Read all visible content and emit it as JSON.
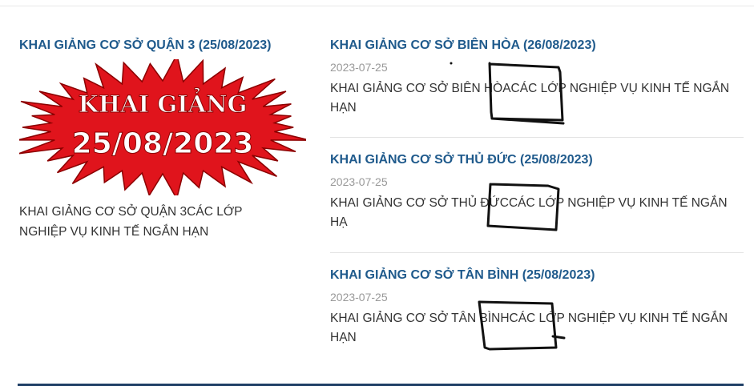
{
  "featured": {
    "title": "KHAI GIẢNG CƠ SỞ QUẬN 3 (25/08/2023)",
    "banner": {
      "line1": "KHAI GIẢNG",
      "line2": "25/08/2023",
      "colors": {
        "burst": "#e0141c",
        "text": "#ffffff",
        "outline": "#8b0000"
      }
    },
    "excerpt": "KHAI GIẢNG CƠ SỞ QUẬN 3CÁC LỚP NGHIỆP VỤ KINH TẾ NGẮN HẠN"
  },
  "news": [
    {
      "title": "KHAI GIẢNG CƠ SỞ BIÊN HÒA (26/08/2023)",
      "date": "2023-07-25",
      "excerpt": "KHAI GIẢNG CƠ SỞ BIÊN HÒACÁC LỚP NGHIỆP VỤ KINH TẾ NGẮN HẠN"
    },
    {
      "title": "KHAI GIẢNG CƠ SỞ THỦ ĐỨC (25/08/2023)",
      "date": "2023-07-25",
      "excerpt": "KHAI GIẢNG CƠ SỞ THỦ ĐỨCCÁC LỚP NGHIỆP VỤ KINH TẾ NGẮN HẠ"
    },
    {
      "title": "KHAI GIẢNG CƠ SỞ TÂN BÌNH (25/08/2023)",
      "date": "2023-07-25",
      "excerpt": "KHAI GIẢNG CƠ SỞ TÂN BÌNHCÁC LỚP NGHIỆP VỤ KINH TẾ NGẮN HẠN"
    }
  ],
  "colors": {
    "title": "#1f5a8c",
    "date": "#999999",
    "text": "#333333",
    "divider": "#1f3f66",
    "annotation": "#111111"
  }
}
